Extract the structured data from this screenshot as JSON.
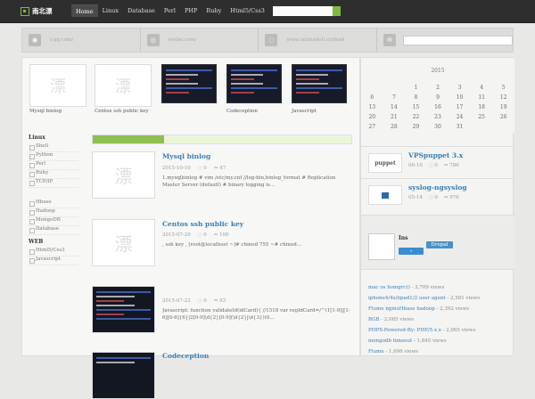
{
  "nav": {
    "logo_text": "南北漂",
    "items": [
      "Home",
      "Linux",
      "Database",
      "Perl",
      "PHP",
      "Ruby",
      "Html5/Css3"
    ]
  },
  "social": [
    {
      "icon": "qq-icon",
      "text": "t.qq.com/"
    },
    {
      "icon": "weibo-icon",
      "text": "weibo.com/"
    },
    {
      "icon": "rss-icon",
      "text": "www.onlinedoll.cn/feed"
    },
    {
      "icon": "mail-icon",
      "text": ""
    }
  ],
  "thumbs": [
    {
      "caption": "Mysql binlog",
      "glyph": "漂"
    },
    {
      "caption": "Centos ssh public key",
      "glyph": "漂"
    },
    {
      "caption": "",
      "glyph": ""
    },
    {
      "caption": "Codeception",
      "glyph": ""
    },
    {
      "caption": "Javascript",
      "glyph": ""
    }
  ],
  "categories": {
    "head1": "Linux",
    "group1": [
      "Shell",
      "Python",
      "Perl",
      "Ruby",
      "TCP/IP"
    ],
    "group2": [
      "Hbase",
      "Hadoop",
      "MongoDB",
      "Database"
    ],
    "head2": "WEB",
    "group3": [
      "Html5/Css3",
      "Javascript"
    ]
  },
  "posts": [
    {
      "title": "Mysql binlog",
      "date": "2015-10-10",
      "comments": "0",
      "views": "47",
      "excerpt": "1.mysqlbinlog                # vim /etc/my.cnf   //log-bin,binlog_format # Replication Master Server (default)     # binary logging is..."
    },
    {
      "title": "Centos ssh public key",
      "date": "2015-07-29",
      "comments": "0",
      "views": "100",
      "excerpt": ", ssh key ,                                                    [root@localhost ~]# chmod 755 ~# chmod..."
    },
    {
      "title": "",
      "date": "2015-07-22",
      "comments": "0",
      "views": "93",
      "excerpt": "Javascript: function validateId(idCard){     //1518     var regIdCard=/^(1[1-9]|[1-6][0-6]{6}|2[0-9]\\d{2}[0-9](\\d{2}|\\d{3})(0..."
    },
    {
      "title": "Codeception",
      "date": "",
      "comments": "",
      "views": "",
      "excerpt": ""
    }
  ],
  "calendar": {
    "title": "2015",
    "days": [
      "",
      "",
      "1",
      "2",
      "3",
      "4",
      "5",
      "6",
      "7",
      "8",
      "9",
      "10",
      "11",
      "12",
      "13",
      "14",
      "15",
      "16",
      "17",
      "18",
      "19",
      "20",
      "21",
      "22",
      "23",
      "24",
      "25",
      "26",
      "27",
      "28",
      "29",
      "30",
      "31",
      "",
      ""
    ]
  },
  "recommended": [
    {
      "title": "VPSpuppet 3.x",
      "date": "06-10",
      "comments": "0",
      "views": "786",
      "image_text": "puppet"
    },
    {
      "title": "syslog-ngsyslog",
      "date": "05-14",
      "comments": "0",
      "views": "976",
      "image_text": ""
    }
  ],
  "login": {
    "ins": "Ins",
    "btn1": "»",
    "btn2": "Drupal"
  },
  "hot": [
    {
      "title": "mac os homgrc()",
      "views": "- 3,709 views"
    },
    {
      "title": "iphone4/4s/iipad1/2 user agent",
      "views": "- 2,581 views"
    },
    {
      "title": "Flume nginxHbase hadoop",
      "views": "- 2,392 views"
    },
    {
      "title": "RGB",
      "views": "- 2,085 views"
    },
    {
      "title": "PHPX-Powered-By: PHP/5.x.x",
      "views": "- 2,065 views"
    },
    {
      "title": "mongodb timeout",
      "views": "- 1,845 views"
    },
    {
      "title": "Flume",
      "views": "- 1,696 views"
    }
  ]
}
